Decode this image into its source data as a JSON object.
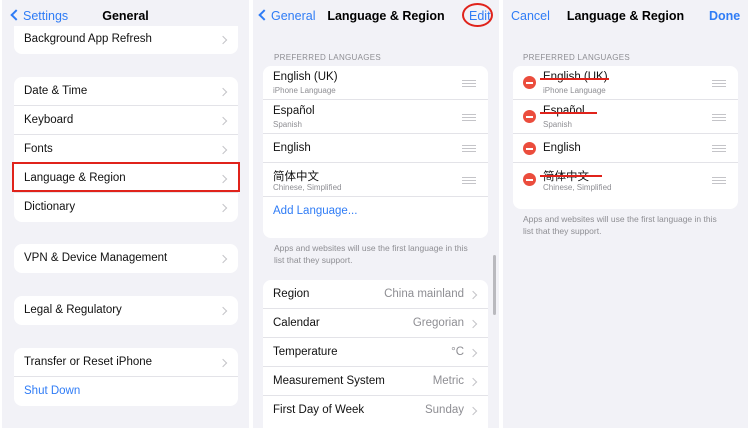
{
  "panel_general": {
    "back_label": "Settings",
    "title": "General",
    "groups": [
      [
        "Background App Refresh"
      ],
      [
        "Date & Time",
        "Keyboard",
        "Fonts",
        "Language & Region",
        "Dictionary"
      ],
      [
        "VPN & Device Management"
      ],
      [
        "Legal & Regulatory"
      ]
    ],
    "transfer_label": "Transfer or Reset iPhone",
    "shutdown_label": "Shut Down"
  },
  "panel_language": {
    "back_label": "General",
    "title": "Language & Region",
    "edit_label": "Edit",
    "preferred_header": "PREFERRED LANGUAGES",
    "languages": [
      {
        "name": "English (UK)",
        "sub": "iPhone Language"
      },
      {
        "name": "Español",
        "sub": "Spanish"
      },
      {
        "name": "English",
        "sub": ""
      },
      {
        "name": "简体中文",
        "sub": "Chinese, Simplified"
      }
    ],
    "add_language": "Add Language...",
    "footnote": "Apps and websites will use the first language in this list that they support.",
    "settings": [
      {
        "label": "Region",
        "value": "China mainland"
      },
      {
        "label": "Calendar",
        "value": "Gregorian"
      },
      {
        "label": "Temperature",
        "value": "°C"
      },
      {
        "label": "Measurement System",
        "value": "Metric"
      },
      {
        "label": "First Day of Week",
        "value": "Sunday"
      }
    ]
  },
  "panel_edit": {
    "cancel_label": "Cancel",
    "title": "Language & Region",
    "done_label": "Done",
    "preferred_header": "PREFERRED LANGUAGES",
    "languages": [
      {
        "name": "English (UK)",
        "sub": "iPhone Language",
        "struck": true
      },
      {
        "name": "Español",
        "sub": "Spanish",
        "struck": true
      },
      {
        "name": "English",
        "sub": "",
        "struck": false
      },
      {
        "name": "简体中文",
        "sub": "Chinese, Simplified",
        "struck": true
      }
    ],
    "footnote": "Apps and websites will use the first language in this list that they support."
  },
  "colors": {
    "accent": "#2f7cf6",
    "annotation_red": "#e0231b",
    "delete_red": "#eb4d3d",
    "background": "#f2f2f7"
  },
  "icons": {
    "back": "chevron-left-icon",
    "disclosure": "chevron-right-icon",
    "reorder": "reorder-handle-icon",
    "delete": "minus-circle-icon"
  }
}
